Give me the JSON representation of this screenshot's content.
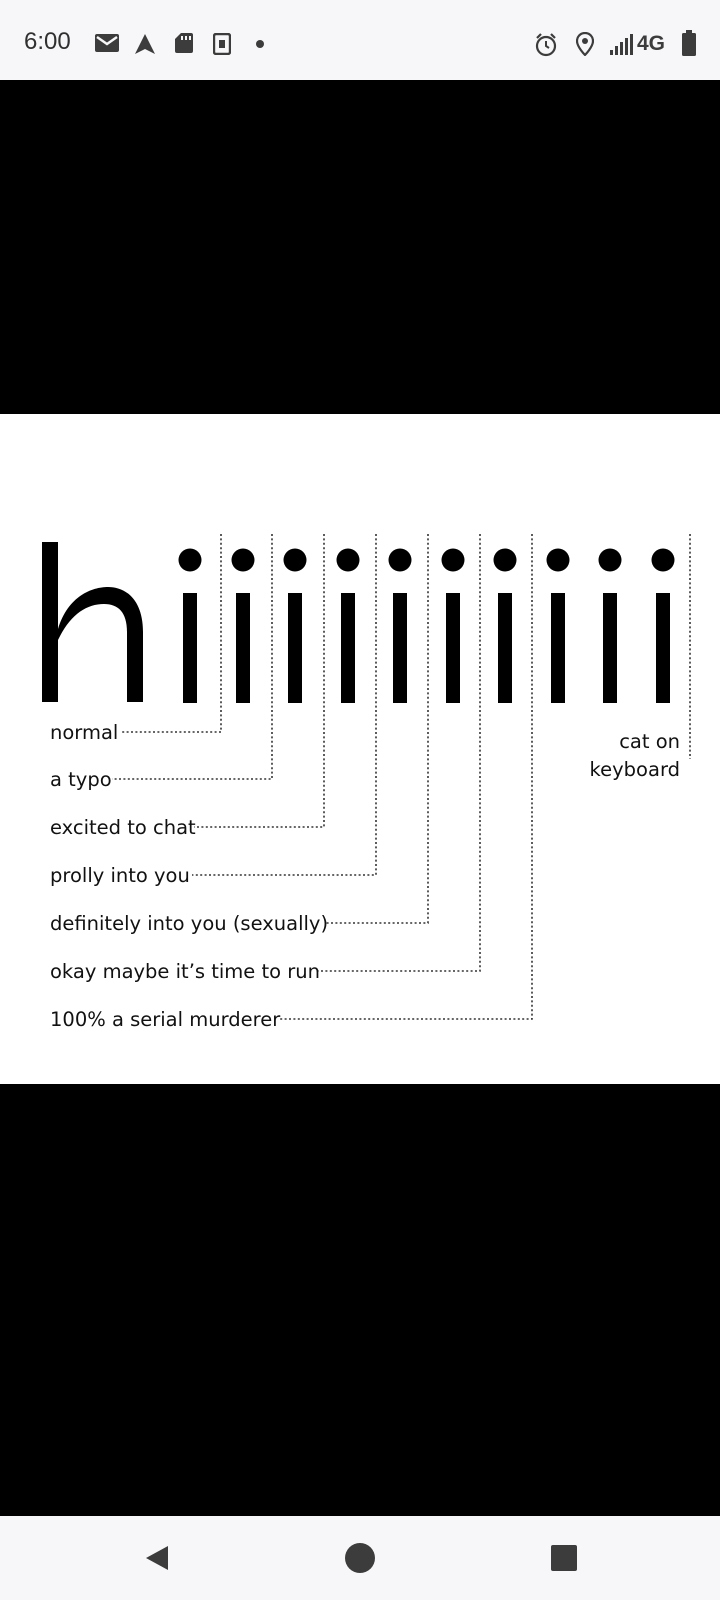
{
  "status_bar": {
    "time": "6:00",
    "left_icons": [
      "gmail-icon",
      "navigation-icon",
      "sd-card-icon",
      "app-notification-icon",
      "dot-icon"
    ],
    "right_icons": [
      "alarm-icon",
      "location-icon",
      "signal-icon",
      "battery-icon"
    ],
    "network": "4G"
  },
  "meme": {
    "big_text": "hiiiiiiiiii",
    "cat_label": "cat on\nkeyboard",
    "labels": [
      "normal",
      "a typo",
      "excited to chat",
      "prolly into you",
      "definitely into you (sexually)",
      "okay maybe it’s time to run",
      "100% a serial murderer"
    ]
  },
  "nav_bar": {
    "buttons": [
      "back-button",
      "home-button",
      "recents-button"
    ]
  }
}
